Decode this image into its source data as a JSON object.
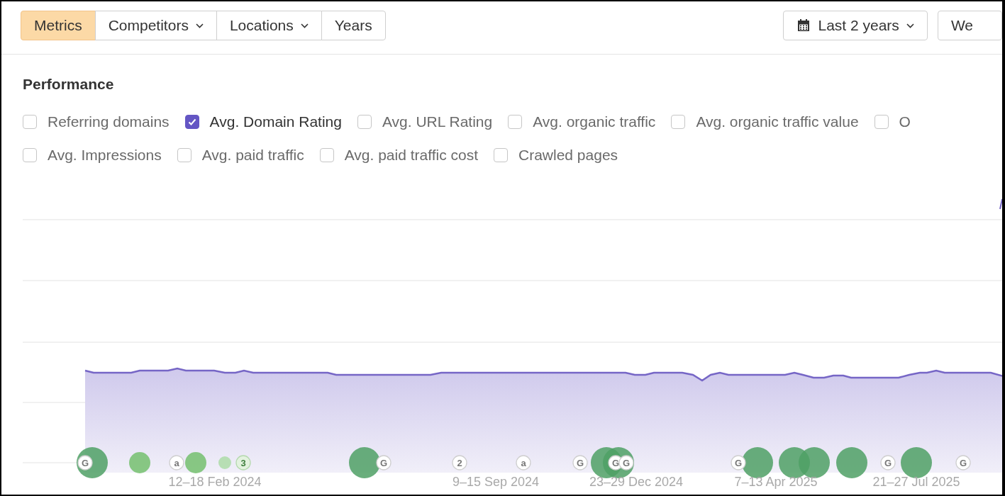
{
  "toolbar": {
    "segments": [
      {
        "label": "Metrics",
        "selected": true,
        "dropdown": false
      },
      {
        "label": "Competitors",
        "selected": false,
        "dropdown": true
      },
      {
        "label": "Locations",
        "selected": false,
        "dropdown": true
      },
      {
        "label": "Years",
        "selected": false,
        "dropdown": false
      }
    ],
    "date_range": {
      "label": "Last 2 years"
    },
    "cut_button": {
      "label": "We"
    }
  },
  "performance": {
    "title": "Performance",
    "metrics": [
      [
        {
          "label": "Referring domains",
          "checked": false
        },
        {
          "label": "Avg. Domain Rating",
          "checked": true
        },
        {
          "label": "Avg. URL Rating",
          "checked": false
        },
        {
          "label": "Avg. organic traffic",
          "checked": false
        },
        {
          "label": "Avg. organic traffic value",
          "checked": false
        },
        {
          "label": "O",
          "checked": false
        }
      ],
      [
        {
          "label": "Avg. Impressions",
          "checked": false
        },
        {
          "label": "Avg. paid traffic",
          "checked": false
        },
        {
          "label": "Avg. paid traffic cost",
          "checked": false
        },
        {
          "label": "Crawled pages",
          "checked": false
        }
      ]
    ],
    "chart": {
      "x_labels": [
        "12–18 Feb 2024",
        "9–15 Sep 2024",
        "23–29 Dec 2024",
        "7–13 Apr 2025",
        "21–27 Jul 2025"
      ],
      "events": [
        {
          "kind": "badge",
          "label": "G",
          "faded": false
        },
        {
          "kind": "bubble-large"
        },
        {
          "kind": "bubble-medium"
        },
        {
          "kind": "badge",
          "label": "a",
          "faded": false
        },
        {
          "kind": "bubble-medium"
        },
        {
          "kind": "bubble-small"
        },
        {
          "kind": "badge",
          "label": "3",
          "faded": true
        },
        {
          "kind": "bubble-large"
        },
        {
          "kind": "badge",
          "label": "G",
          "faded": false
        },
        {
          "kind": "badge",
          "label": "2",
          "faded": false
        },
        {
          "kind": "badge",
          "label": "a",
          "faded": false
        },
        {
          "kind": "badge",
          "label": "G",
          "faded": false
        },
        {
          "kind": "bubble-large"
        },
        {
          "kind": "bubble-large"
        },
        {
          "kind": "badge",
          "label": "G",
          "faded": false
        },
        {
          "kind": "badge",
          "label": "G",
          "faded": false
        },
        {
          "kind": "badge",
          "label": "G",
          "faded": false
        },
        {
          "kind": "bubble-large"
        },
        {
          "kind": "bubble-large"
        },
        {
          "kind": "bubble-large"
        },
        {
          "kind": "bubble-large"
        },
        {
          "kind": "badge",
          "label": "G",
          "faded": false
        },
        {
          "kind": "bubble-large"
        },
        {
          "kind": "badge",
          "label": "G",
          "faded": false
        }
      ]
    }
  }
}
